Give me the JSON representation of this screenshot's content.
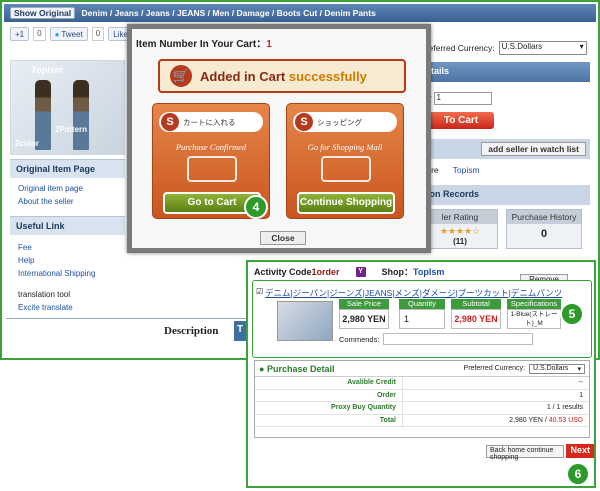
{
  "breadcrumb": {
    "show_original": "Show Original",
    "path": "Denim / Jeans / Jeans / JEANS / Men / Damage / Boots Cut / Denim Pants"
  },
  "social": {
    "gplus": "+1",
    "gplus_count": "0",
    "tweet": "Tweet",
    "tweet_count": "0",
    "like": "Like"
  },
  "left": {
    "img_text_top": "TopIsm",
    "img_text_a": "2color",
    "img_text_b": "2Pattern",
    "original_item_page_header": "Original Item Page",
    "original_item_page_link": "Original item page",
    "about_seller_link": "About the seller",
    "useful_link_header": "Useful Link",
    "links": [
      "Fee",
      "Help",
      "International Shipping"
    ],
    "translation_tool": "translation tool",
    "excite_translate": "Excite translate"
  },
  "right": {
    "preferred_currency_label": "Preferred Currency:",
    "currency_value": "U.S.Dollars",
    "details_bar": "etails",
    "qty_label": "tity",
    "qty_value": "1",
    "to_cart": "To Cart",
    "seller_bar_prefix": "o",
    "add_seller_btn": "add seller in watch list",
    "store_label": "tore",
    "store_name": "Topism",
    "records_bar": "tion Records",
    "seller_rating_header": "ler Rating",
    "seller_rating_count": "(11)",
    "purchase_history_header": "Purchase History",
    "purchase_history_value": "0"
  },
  "description": {
    "label": "Description",
    "tab": "T"
  },
  "dialog": {
    "title": "Item Number In Your Cart：",
    "count": "1",
    "ribbon_text": "Added in Cart ",
    "ribbon_success": "successfully",
    "left_card_jp": "カートに入れる",
    "left_card_caption": "Purchase Confirmed",
    "left_card_button": "Go to Cart",
    "right_card_jp": "ショッピング",
    "right_card_caption": "Go for Shopping Mall",
    "right_card_button": "Continue Shopping",
    "close": "Close",
    "badge": "4"
  },
  "cart": {
    "activity_label": "Activity Code",
    "activity_value": "1order",
    "shop_label": "Shop：",
    "shop_name": "TopIsm",
    "remove": "Remove",
    "item_title": "デニム|ジーパン|ジーンズ|JEANS|メンズ|ダメージ|ブーツカット|デニムパンツ",
    "headers": [
      "Sale Price",
      "Quantity",
      "Subtotal",
      "Specifications"
    ],
    "sale_price": "2,980 YEN",
    "quantity": "1",
    "subtotal": "2,980 YEN",
    "specifications": "1-Blue(ストレート)_M",
    "comments_label": "Commends:",
    "badge": "5"
  },
  "purchase_detail": {
    "title": "Purchase Detail",
    "currency_label": "Preferred Currency:",
    "currency_value": "U.S.Dollars",
    "rows": [
      {
        "k": "Avalible Credit",
        "v": "--"
      },
      {
        "k": "Order",
        "v": "1"
      },
      {
        "k": "Proxy Buy Quantity",
        "v": "1 / 1 results"
      },
      {
        "k": "Total",
        "v": "2,980 YEN / ",
        "usd": "40.53 USD"
      }
    ],
    "home_btn": "Back home continue shopping",
    "next_btn": "Next",
    "badge": "6"
  },
  "colors": {
    "accent_green": "#3aa33a",
    "header_blue": "#4c74a4",
    "alert_red": "#c22"
  }
}
